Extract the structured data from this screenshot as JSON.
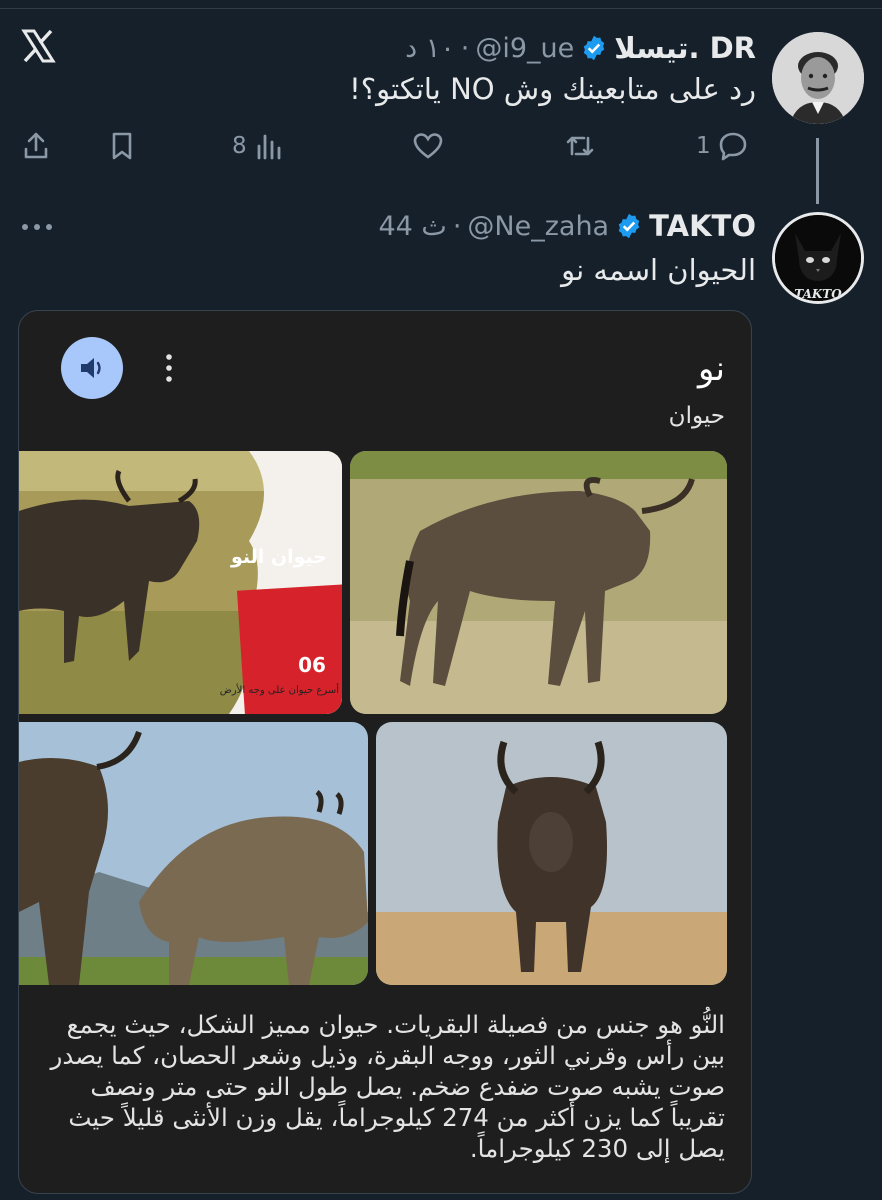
{
  "tweet1": {
    "display_name": "تيسلا. DR",
    "handle": "@i9_ue",
    "time": "١٠ د",
    "text": "رد على متابعينك وش NO ياتكتو؟!",
    "views": "8",
    "replies": "1"
  },
  "tweet2": {
    "display_name": "TAKTO",
    "handle": "@Ne_zaha",
    "time": "44 ث",
    "text": "الحيوان اسمه نو",
    "avatar_text": "TAKTO"
  },
  "card": {
    "title": "نو",
    "subtitle": "حيوان",
    "image1_banner": "حيوان النو",
    "image1_badge": "06",
    "image1_caption": "أسرع حيوان على وجه الأرض",
    "description": "النُّو هو جنس من فصيلة البقريات. حيوان مميز الشكل، حيث يجمع بين رأس وقرني الثور، ووجه البقرة، وذيل وشعر الحصان، كما يصدر صوت يشبه صوت ضفدع ضخم. يصل طول النو حتى متر ونصف تقريباً كما يزن أكثر من 274 كيلوجراماً، يقل وزن الأنثى قليلاً حيث يصل إلى 230 كيلوجراماً."
  },
  "colors": {
    "background": "#15202b",
    "text_primary": "#e7e9ea",
    "text_secondary": "#8b98a5",
    "verified": "#1d9bf0",
    "card_background": "#1e1e1e",
    "sound_button": "#a8c7fa"
  },
  "icons": {
    "logo": "x-logo-icon",
    "verified": "verified-badge-icon",
    "share": "share-icon",
    "bookmark": "bookmark-icon",
    "views": "views-chart-icon",
    "like": "heart-icon",
    "retweet": "retweet-icon",
    "reply": "reply-icon",
    "more": "more-horizontal-icon",
    "speaker": "speaker-icon",
    "kebab": "more-vertical-icon"
  }
}
